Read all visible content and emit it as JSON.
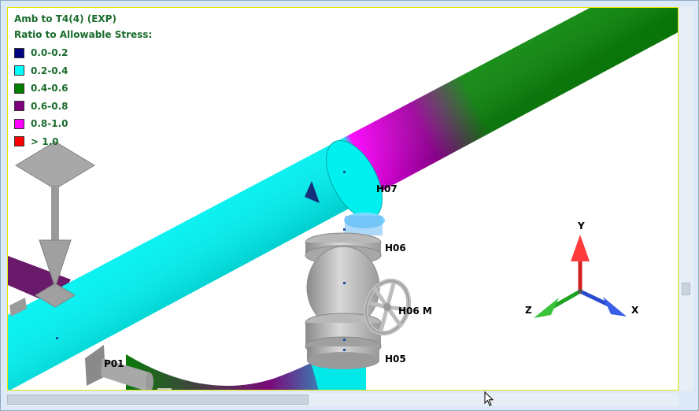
{
  "legend": {
    "title": "Amb to T4(4)  (EXP)",
    "subtitle": "Ratio to Allowable Stress:",
    "items": [
      {
        "label": "0.0-0.2",
        "color": "#000080"
      },
      {
        "label": "0.2-0.4",
        "color": "#00ffff"
      },
      {
        "label": "0.4-0.6",
        "color": "#008000"
      },
      {
        "label": "0.6-0.8",
        "color": "#800080"
      },
      {
        "label": "0.8-1.0",
        "color": "#ff00ff"
      },
      {
        "label": "> 1.0",
        "color": "#ff0000"
      }
    ]
  },
  "nodes": {
    "h07": "H07",
    "h06": "H06",
    "h06m": "H06 M",
    "h05": "H05",
    "p01": "P01"
  },
  "axes": {
    "x": "X",
    "y": "Y",
    "z": "Z",
    "x_color": "#3a5ee8",
    "y_color": "#e23a3a",
    "z_color": "#3ac23a"
  }
}
